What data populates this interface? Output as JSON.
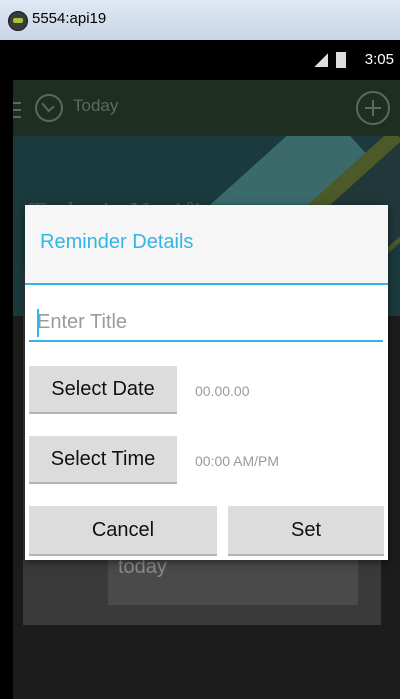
{
  "window": {
    "title": "5554:api19"
  },
  "status_bar": {
    "time": "3:05"
  },
  "action_bar": {
    "title": "Today"
  },
  "banner": {
    "title": "Today's Notification"
  },
  "empty_state": {
    "message": "No Reminders set for today"
  },
  "dialog": {
    "title": "Reminder Details",
    "title_placeholder": "Enter Title",
    "select_date_label": "Select Date",
    "date_value": "00.00.00",
    "select_time_label": "Select Time",
    "time_value": "00:00 AM/PM",
    "cancel_label": "Cancel",
    "set_label": "Set"
  },
  "colors": {
    "accent": "#33b5e5",
    "action_bar": "#1e2f22"
  }
}
